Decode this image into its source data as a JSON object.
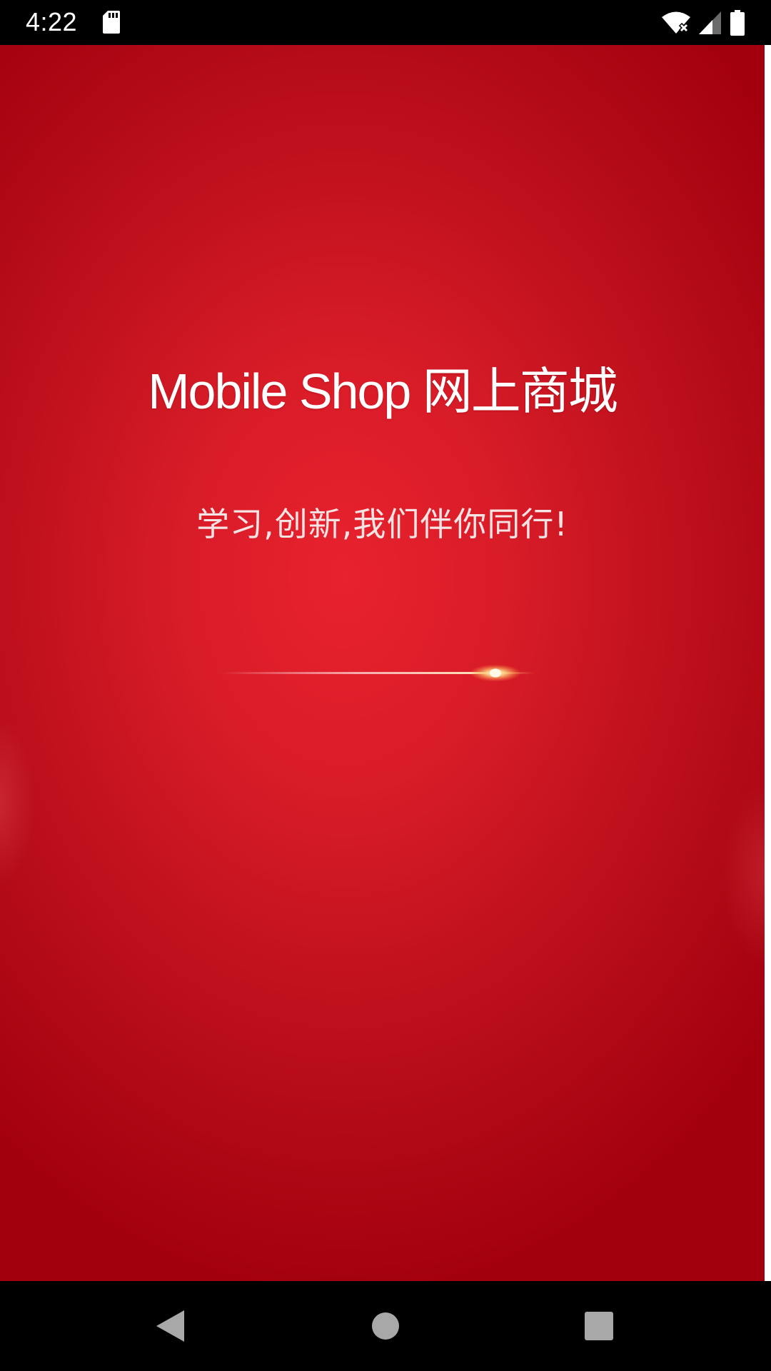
{
  "status_bar": {
    "time": "4:22",
    "icons": [
      "sd-card-icon",
      "wifi-off-icon",
      "cell-signal-icon",
      "battery-icon"
    ]
  },
  "splash": {
    "title": "Mobile Shop 网上商城",
    "slogan": "学习,创新,我们伴你同行!",
    "colors": {
      "center": "#e8222e",
      "edge": "#a3000e",
      "text": "#ffffff",
      "streak_highlight": "#ffd98a"
    }
  },
  "nav_bar": {
    "buttons": [
      "back-icon",
      "home-icon",
      "recents-icon"
    ]
  }
}
